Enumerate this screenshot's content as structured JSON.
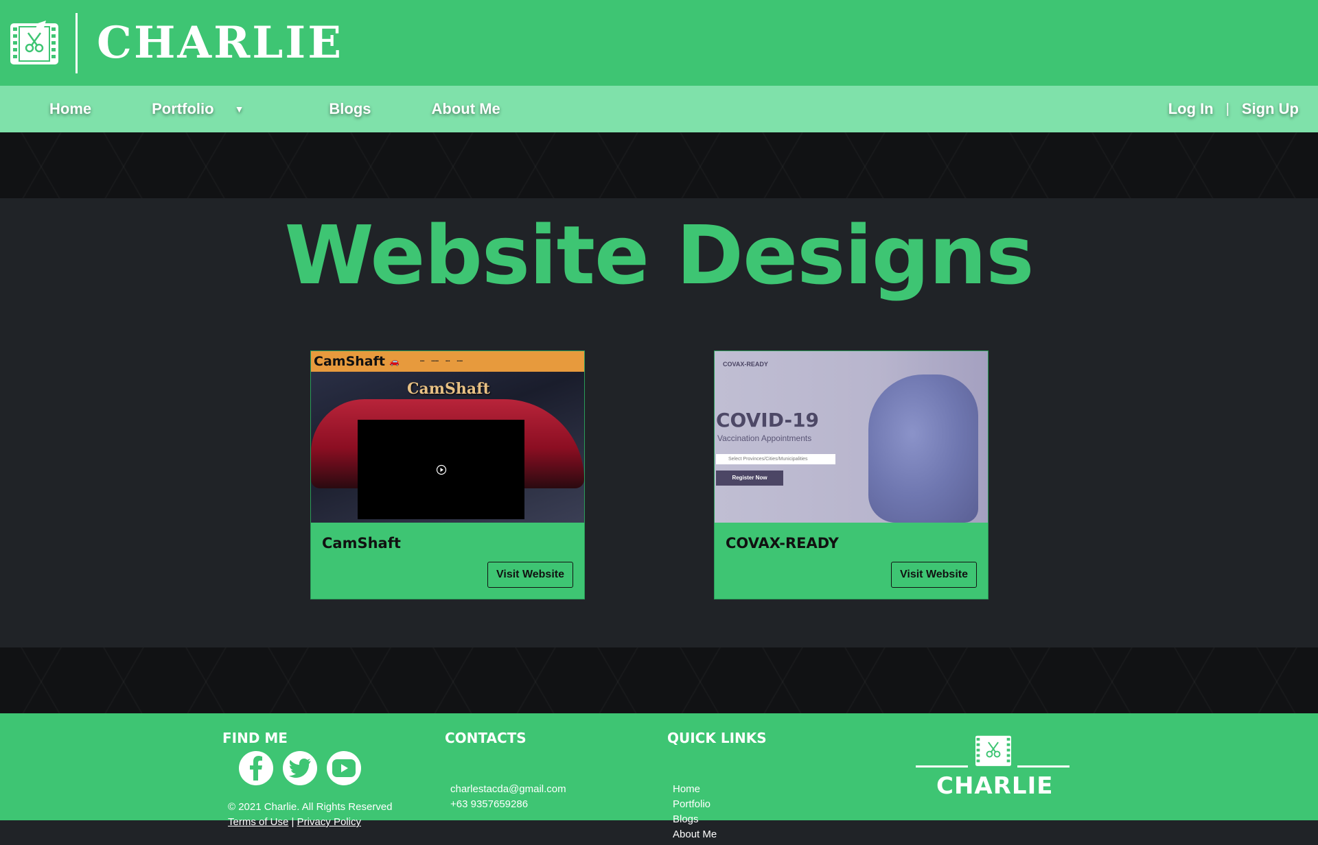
{
  "brand": {
    "name": "CHARLIE"
  },
  "nav": {
    "items": [
      {
        "label": "Home"
      },
      {
        "label": "Portfolio"
      },
      {
        "label": "Blogs"
      },
      {
        "label": "About Me"
      }
    ],
    "login_label": "Log In",
    "separator": "|",
    "signup_label": "Sign Up"
  },
  "main": {
    "title": "Website Designs",
    "cards": [
      {
        "name": "CamShaft",
        "button_label": "Visit Website",
        "thumbnail": {
          "logo": "CamShaft",
          "brand": "CamShaft"
        }
      },
      {
        "name": "COVAX-READY",
        "button_label": "Visit Website",
        "thumbnail": {
          "brand": "COVAX-READY",
          "headline": "COVID-19",
          "subheadline": "Vaccination Appointments",
          "input_placeholder": "Select Provinces/Cities/Municipalities",
          "button": "Register Now"
        }
      }
    ]
  },
  "footer": {
    "find_me": {
      "title": "FIND ME",
      "socials": [
        "facebook-icon",
        "twitter-icon",
        "youtube-icon"
      ],
      "copyright": "© 2021 Charlie. All Rights Reserved",
      "terms": "Terms of Use",
      "legal_sep": "|",
      "privacy": "Privacy Policy"
    },
    "contacts": {
      "title": "CONTACTS",
      "email": "charlestacda@gmail.com",
      "phone": "+63 9357659286"
    },
    "quick_links": {
      "title": "QUICK LINKS",
      "links": [
        "Home",
        "Portfolio",
        "Blogs",
        "About Me"
      ]
    },
    "logo_text": "CHARLIE"
  },
  "colors": {
    "brand_green": "#3ec573",
    "nav_green": "#7fe1aa",
    "dark_bg": "#202327",
    "pattern_bg": "#111214"
  }
}
